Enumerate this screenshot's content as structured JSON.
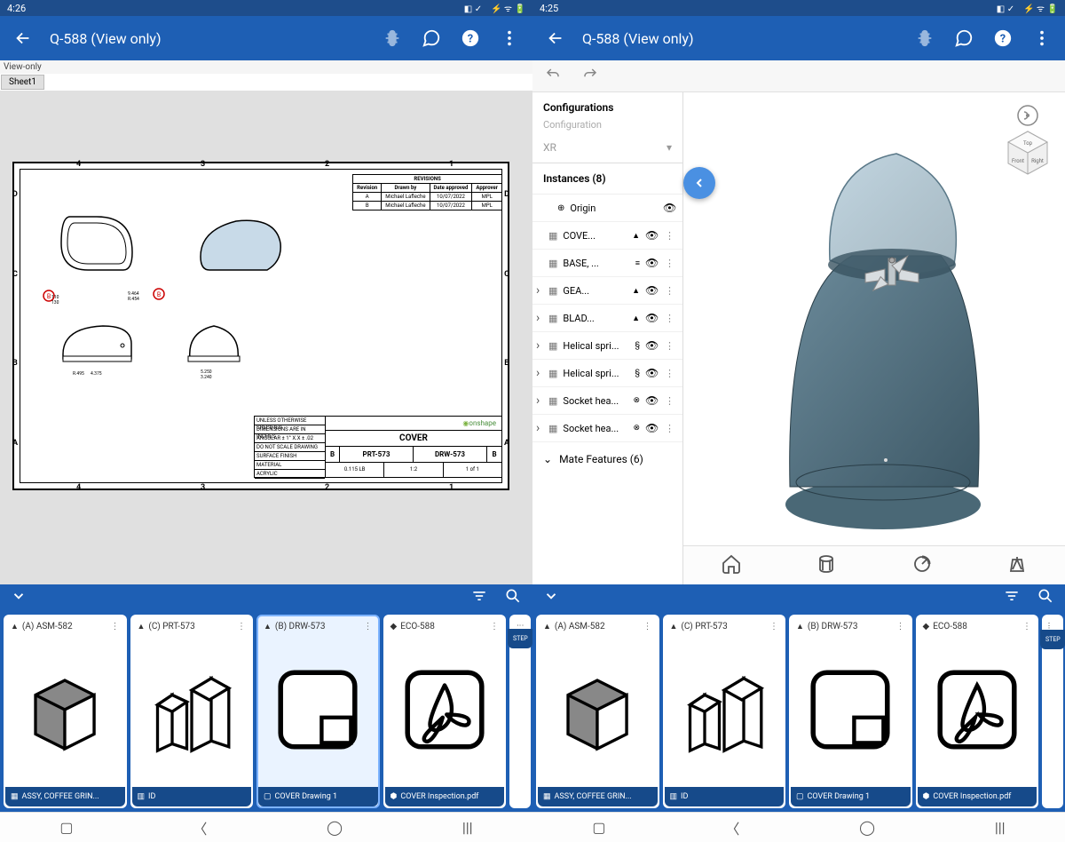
{
  "left": {
    "status_time": "4:26",
    "title": "Q-588 (View only)",
    "view_only_label": "View-only",
    "sheet_label": "Sheet1",
    "drawing": {
      "zones_top": [
        "4",
        "3",
        "2",
        "1"
      ],
      "zones_bottom": [
        "4",
        "3",
        "2",
        "1"
      ],
      "zones_left": [
        "D",
        "C",
        "B",
        "A"
      ],
      "zones_right": [
        "D",
        "C",
        "B",
        "A"
      ],
      "revisions_header": "REVISIONS",
      "revisions_cols": [
        "Revision",
        "Drawn by",
        "Date approved",
        "Approver"
      ],
      "revisions": [
        {
          "rev": "A",
          "by": "Michael Lafleche",
          "date": "10/07/2022",
          "appr": "MPL"
        },
        {
          "rev": "B",
          "by": "Michael Lafleche",
          "date": "10/07/2022",
          "appr": "MPL"
        }
      ],
      "title_block": {
        "notes": [
          "UNLESS OTHERWISE SPECIFIED",
          "DIMENSIONS ARE IN INCHES",
          "ANGULAR ± 1°  X.X ± .02",
          "DO NOT SCALE DRAWING",
          "SURFACE FINISH",
          "MATERIAL",
          "ACRYLIC"
        ],
        "brand": "onshape",
        "part_title": "COVER",
        "rev_letter": "B",
        "part_no": "PRT-573",
        "drw_no": "DRW-573",
        "sheet_rev": "B",
        "weight": "0.115 LB",
        "scale": "1:2",
        "sheet": "1 of 1"
      },
      "dims": [
        "110",
        "130",
        "9.464",
        "R.454",
        "R.495",
        "4.375",
        "5.250",
        "3.240"
      ]
    }
  },
  "right": {
    "status_time": "4:25",
    "title": "Q-588 (View only)",
    "panel": {
      "configs_title": "Configurations",
      "config_label": "Configuration",
      "config_value": "XR",
      "instances_title": "Instances (8)",
      "origin_label": "Origin",
      "items": [
        {
          "name": "COVE...",
          "glyph": "tri"
        },
        {
          "name": "BASE, ...",
          "glyph": "mate"
        },
        {
          "name": "GEA...",
          "glyph": "tri",
          "expandable": true
        },
        {
          "name": "BLAD...",
          "glyph": "tri",
          "expandable": true
        },
        {
          "name": "Helical spri...",
          "glyph": "spr",
          "expandable": true
        },
        {
          "name": "Helical spri...",
          "glyph": "spr",
          "expandable": true
        },
        {
          "name": "Socket hea...",
          "glyph": "scr",
          "expandable": true
        },
        {
          "name": "Socket hea...",
          "glyph": "scr",
          "expandable": true
        }
      ],
      "mate_label": "Mate Features (6)"
    },
    "cube": {
      "top": "Top",
      "front": "Front",
      "right": "Right"
    }
  },
  "thumbs": [
    {
      "label": "(A) ASM-582",
      "footer": "ASSY, COFFEE GRIN...",
      "type": "asm"
    },
    {
      "label": "(C) PRT-573",
      "footer": "ID",
      "type": "prt"
    },
    {
      "label": "(B) DRW-573",
      "footer": "COVER Drawing 1",
      "type": "drw",
      "active_left": true
    },
    {
      "label": "ECO-588",
      "footer": "COVER Inspection.pdf",
      "type": "pdf"
    }
  ]
}
